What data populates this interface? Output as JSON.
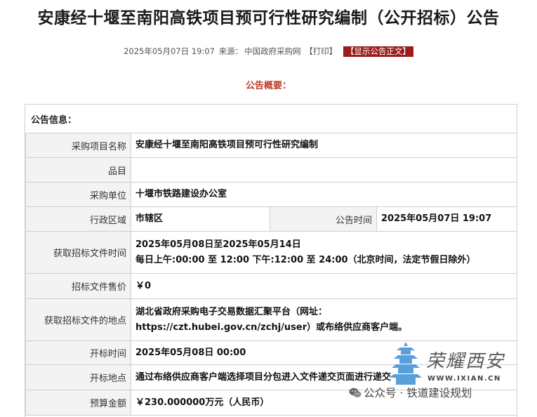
{
  "title": "安康经十堰至南阳高铁项目预可行性研究编制（公开招标）公告",
  "meta": {
    "date": "2025年05月07日 19:07",
    "source_label": "来源：",
    "source": "中国政府采购网",
    "print": "【打印】",
    "show_full": "【显示公告正文】"
  },
  "summary_heading": "公告概要：",
  "info_heading": "公告信息：",
  "rows": [
    {
      "label": "采购项目名称",
      "value": "安康经十堰至南阳高铁项目预可行性研究编制"
    },
    {
      "label": "品目",
      "value": ""
    },
    {
      "label": "采购单位",
      "value": "十堰市铁路建设办公室"
    },
    {
      "label": "行政区域",
      "value": "市辖区",
      "label2": "公告时间",
      "value2": "2025年05月07日 19:07"
    },
    {
      "label": "获取招标文件时间",
      "value_line1": "2025年05月08日至2025年05月14日",
      "value_line2": "每日上午:00:00 至 12:00  下午:12:00 至 24:00（北京时间，法定节假日除外）"
    },
    {
      "label": "招标文件售价",
      "value": "￥0"
    },
    {
      "label": "获取招标文件的地点",
      "value_line1": "湖北省政府采购电子交易数据汇聚平台（网址：",
      "value_line2": "https://czt.hubei.gov.cn/zchj/user）或布络供应商客户端。"
    },
    {
      "label": "开标时间",
      "value": "2025年05月08日 00:00"
    },
    {
      "label": "开标地点",
      "value": "通过布络供应商客户端选择项目分包进入文件递交页面进行递交"
    },
    {
      "label": "预算金额",
      "value": "￥230.000000万元（人民币）"
    }
  ],
  "watermark": {
    "brand": "荣耀西安",
    "url": "WWW.IXIAN.CN",
    "wechat": "公众号 · 铁道建设规划"
  }
}
